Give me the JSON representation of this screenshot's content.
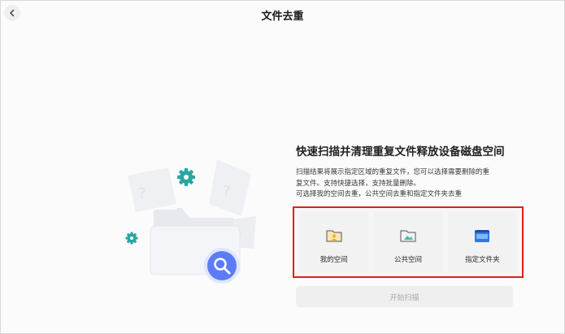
{
  "header": {
    "title": "文件去重",
    "back_icon": "chevron-left-icon"
  },
  "main": {
    "headline": "快速扫描并清理重复文件释放设备磁盘空间",
    "description_lines": [
      "扫描结果将展示指定区域的重复文件，您可以选择需要删除的重",
      "复文件。支持快捷选择，支持批量删除。",
      "可选择我的空间去重，公共空间去重和指定文件夹去重"
    ],
    "options": [
      {
        "label": "我的空间",
        "icon": "my-space-folder-icon"
      },
      {
        "label": "公共空间",
        "icon": "public-space-folder-icon"
      },
      {
        "label": "指定文件夹",
        "icon": "specified-folder-icon"
      }
    ],
    "start_button": "开始扫描"
  },
  "illustration": {
    "icons": [
      "folder-icon",
      "magnifier-icon",
      "gear-icon",
      "question-mark-icon"
    ]
  },
  "colors": {
    "highlight_border": "#e01e1e",
    "magnifier_accent": "#5b7cf5",
    "gear_teal": "#2aa7a2",
    "disabled_text": "#a8a8a8"
  }
}
